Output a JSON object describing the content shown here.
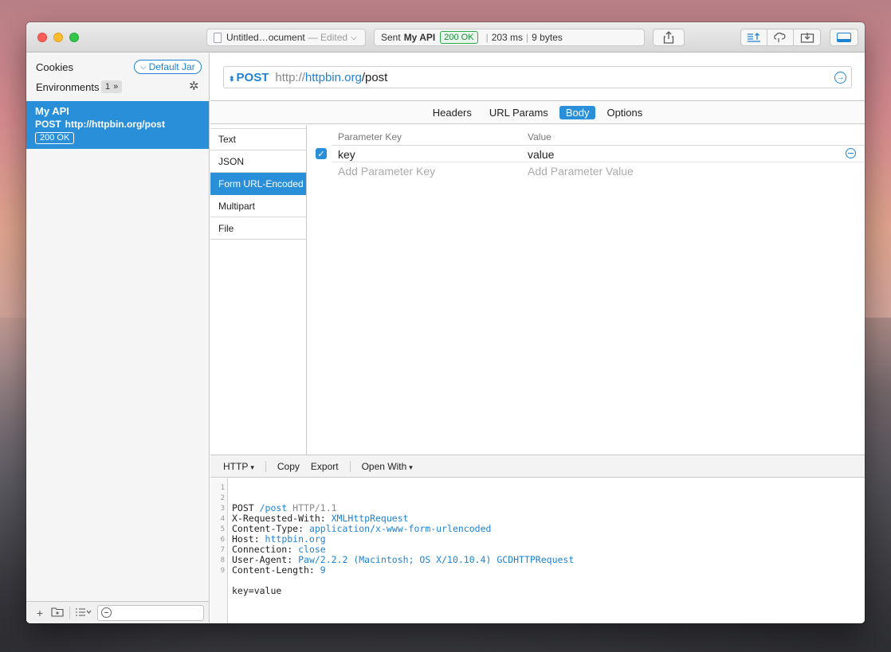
{
  "titlebar": {
    "document_name": "Untitled…ocument",
    "document_state": "— Edited",
    "sent_label": "Sent",
    "sent_request": "My API",
    "status_badge": "200 OK",
    "duration": "203 ms",
    "size": "9 bytes"
  },
  "sidebar": {
    "cookies_label": "Cookies",
    "cookie_jar": "Default Jar",
    "environments_label": "Environments",
    "environments_count": "1",
    "request": {
      "name": "My API",
      "method": "POST",
      "url": "http://httpbin.org/post",
      "status": "200 OK"
    }
  },
  "request": {
    "method": "POST",
    "url_scheme": "http://",
    "url_host": "httpbin.org",
    "url_path": "/post"
  },
  "tabs": [
    "Headers",
    "URL Params",
    "Body",
    "Options"
  ],
  "active_tab": "Body",
  "body_types": [
    "Text",
    "JSON",
    "Form URL-Encoded",
    "Multipart",
    "File"
  ],
  "active_body_type": "Form URL-Encoded",
  "params": {
    "key_header": "Parameter Key",
    "value_header": "Value",
    "rows": [
      {
        "key": "key",
        "value": "value",
        "enabled": true
      }
    ],
    "key_placeholder": "Add Parameter Key",
    "value_placeholder": "Add Parameter Value"
  },
  "http_toolbar": {
    "format": "HTTP",
    "copy": "Copy",
    "export": "Export",
    "open_with": "Open With"
  },
  "http_lines": [
    {
      "n": "1",
      "parts": [
        "POST ",
        "/post",
        " HTTP/1.1"
      ]
    },
    {
      "n": "2",
      "parts": [
        "X-Requested-With: ",
        "XMLHttpRequest"
      ]
    },
    {
      "n": "3",
      "parts": [
        "Content-Type: ",
        "application/x-www-form-urlencoded"
      ]
    },
    {
      "n": "4",
      "parts": [
        "Host: ",
        "httpbin.org"
      ]
    },
    {
      "n": "5",
      "parts": [
        "Connection: ",
        "close"
      ]
    },
    {
      "n": "6",
      "parts": [
        "User-Agent: ",
        "Paw/2.2.2 (Macintosh; OS X/10.10.4) GCDHTTPRequest"
      ]
    },
    {
      "n": "7",
      "parts": [
        "Content-Length: ",
        "9"
      ]
    },
    {
      "n": "8",
      "parts": [
        ""
      ]
    },
    {
      "n": "9",
      "parts": [
        "key=value"
      ]
    }
  ],
  "colors": {
    "accent": "#2a8fd9",
    "status_ok": "#2ea84a"
  }
}
